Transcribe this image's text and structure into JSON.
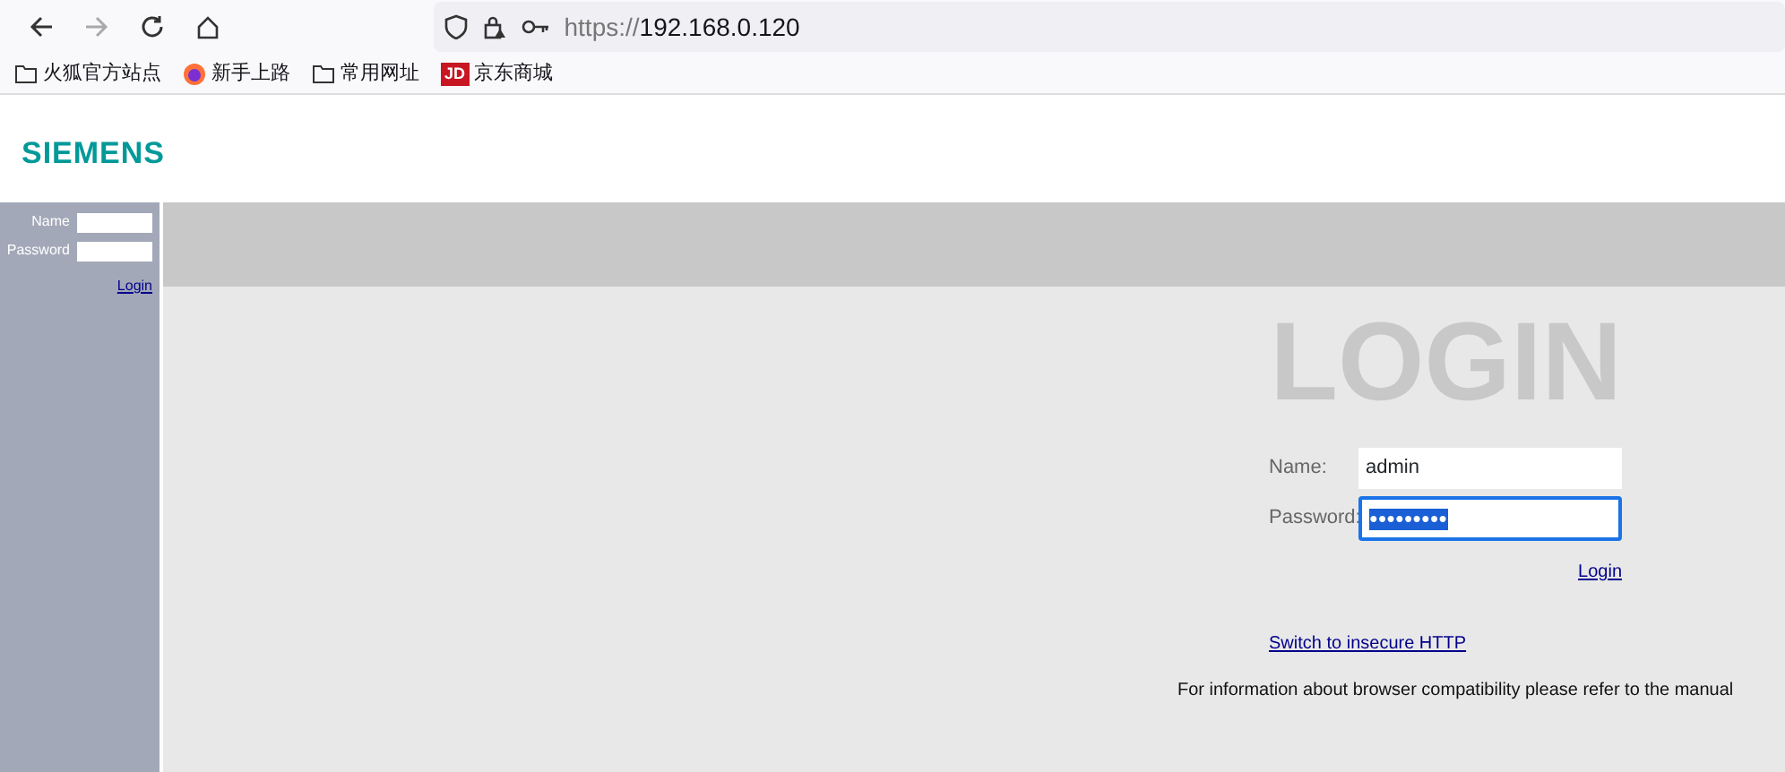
{
  "browser": {
    "url_scheme": "https://",
    "url_host": "192.168.0.120",
    "bookmarks": [
      {
        "kind": "folder",
        "label": "火狐官方站点"
      },
      {
        "kind": "firefox",
        "label": "新手上路"
      },
      {
        "kind": "folder",
        "label": "常用网址"
      },
      {
        "kind": "jd",
        "label": "京东商城",
        "badge": "JD"
      }
    ]
  },
  "header": {
    "logo": "SIEMENS"
  },
  "sidebar": {
    "name_label": "Name",
    "password_label": "Password",
    "login_link": "Login"
  },
  "login": {
    "title": "LOGIN",
    "name_label": "Name:",
    "name_value": "admin",
    "password_label": "Password:",
    "password_value": "●●●●●●●●●",
    "password_focused": true,
    "password_selected": true,
    "login_link": "Login",
    "switch_link": "Switch to insecure HTTP",
    "info": "For information about browser compatibility please refer to the manual"
  }
}
